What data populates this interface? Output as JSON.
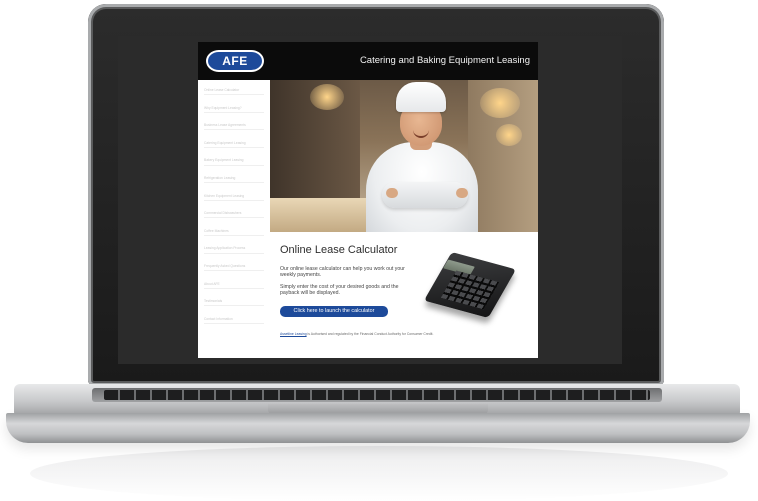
{
  "header": {
    "logo_text": "AFE",
    "tagline": "Catering and Baking Equipment Leasing"
  },
  "sidebar": {
    "items": [
      {
        "label": "Online Lease Calculator"
      },
      {
        "label": "Why Equipment Leasing?"
      },
      {
        "label": "Business Lease Agreements"
      },
      {
        "label": "Catering Equipment Leasing"
      },
      {
        "label": "Bakery Equipment Leasing"
      },
      {
        "label": "Refrigeration Leasing"
      },
      {
        "label": "Kitchen Equipment Leasing"
      },
      {
        "label": "Commercial Dishwashers"
      },
      {
        "label": "Coffee Machines"
      },
      {
        "label": "Leasing Application Process"
      },
      {
        "label": "Frequently Asked Questions"
      },
      {
        "label": "About AFE"
      },
      {
        "label": "Testimonials"
      },
      {
        "label": "Contact Information"
      }
    ]
  },
  "main": {
    "calculator_title": "Online Lease Calculator",
    "paragraph_1": "Our online lease calculator can help you work out your weekly payments.",
    "paragraph_2": "Simply enter the cost of your desired goods and the payback will be displayed.",
    "button_label": "Click here to launch the calculator",
    "footer_link": "Assetline Leasing",
    "footer_text": " is Authorised and regulated by the Financial Conduct Authority for Consumer Credit."
  },
  "colors": {
    "brand_blue": "#1d4a9a",
    "header_black": "#0b0b0b"
  }
}
